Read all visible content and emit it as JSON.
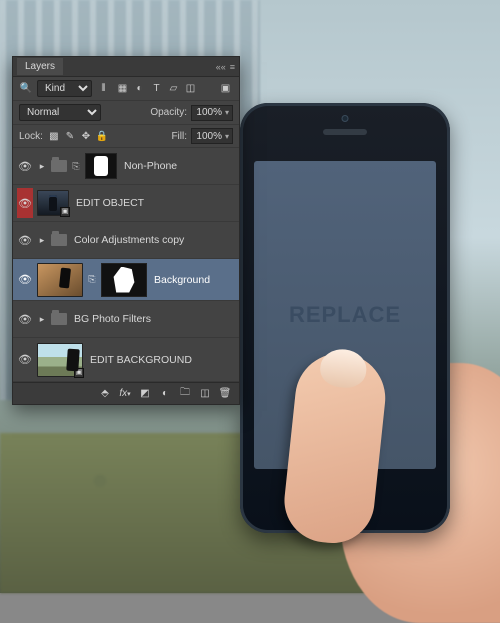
{
  "screen_watermark": "RePLACE",
  "panel": {
    "tab_label": "Layers",
    "filter": {
      "search_icon": "search-icon",
      "kind_label": "Kind",
      "selected_kind": "Kind",
      "type_icons": [
        "pixel",
        "adjustment",
        "type",
        "shape",
        "smartobject"
      ]
    },
    "blend": {
      "mode": "Normal",
      "opacity_label": "Opacity:",
      "opacity_value": "100%"
    },
    "lock": {
      "label": "Lock:",
      "fill_label": "Fill:",
      "fill_value": "100%"
    },
    "layers": [
      {
        "id": "non-phone",
        "name": "Non-Phone",
        "visible": true,
        "expanded": false,
        "type": "group-masked"
      },
      {
        "id": "edit-object",
        "name": "EDIT OBJECT",
        "visible": true,
        "type": "smartobject",
        "highlight": "red"
      },
      {
        "id": "color-adj",
        "name": "Color Adjustments copy",
        "visible": true,
        "expanded": false,
        "type": "group"
      },
      {
        "id": "background",
        "name": "Background",
        "visible": true,
        "type": "masked-image",
        "selected": true
      },
      {
        "id": "bg-filters",
        "name": "BG Photo Filters",
        "visible": true,
        "expanded": false,
        "type": "group"
      },
      {
        "id": "edit-bg",
        "name": "EDIT BACKGROUND",
        "visible": true,
        "type": "smartobject"
      }
    ],
    "footer_buttons": [
      "link",
      "fx",
      "mask",
      "adjustment",
      "group",
      "new",
      "trash"
    ]
  }
}
